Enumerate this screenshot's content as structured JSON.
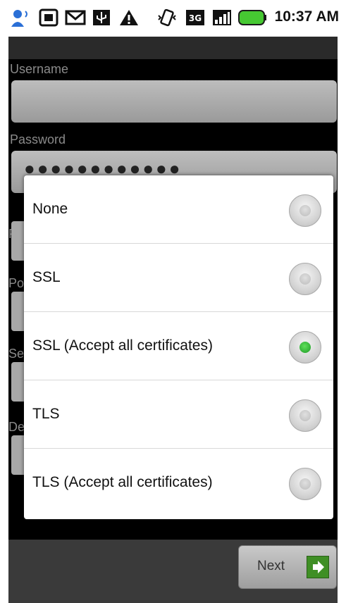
{
  "status_bar": {
    "time": "10:37 AM",
    "icons": [
      "person-icon",
      "sd-card-icon",
      "gmail-icon",
      "usb-icon",
      "warning-icon",
      "vibrate-icon",
      "3g-icon",
      "signal-icon",
      "battery-icon"
    ]
  },
  "form": {
    "username_label": "Username",
    "password_label": "Password",
    "password_value": "●●●●●●●●●●●●",
    "partial_labels": [
      "PC",
      "Po",
      "Se",
      "De"
    ]
  },
  "dialog": {
    "options": [
      {
        "label": "None",
        "checked": false
      },
      {
        "label": "SSL",
        "checked": false
      },
      {
        "label": "SSL (Accept all certificates)",
        "checked": true
      },
      {
        "label": "TLS",
        "checked": false
      },
      {
        "label": "TLS (Accept all certificates)",
        "checked": false
      }
    ]
  },
  "bottom": {
    "next_label": "Next"
  },
  "colors": {
    "accent_green": "#3f8f25",
    "radio_selected": "#2fbf33",
    "background": "#000000"
  }
}
